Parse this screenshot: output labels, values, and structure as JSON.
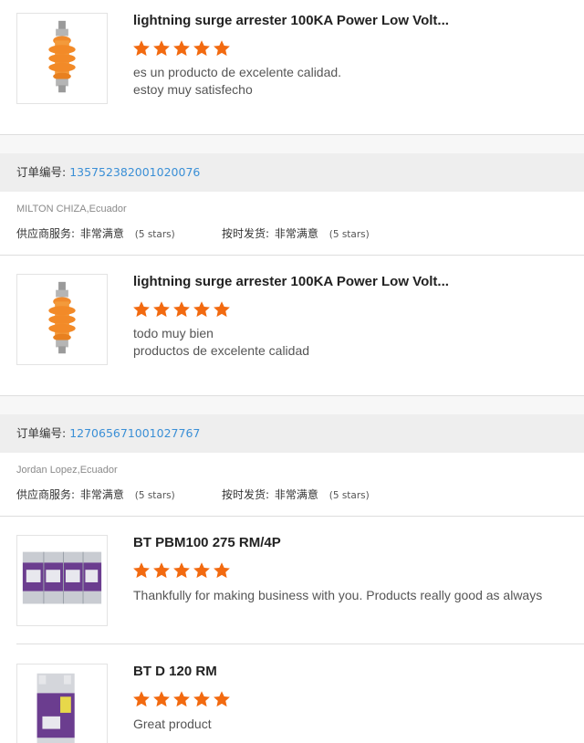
{
  "colors": {
    "star": "#f26a10",
    "order_link": "#3a8fd6"
  },
  "rating_stars": 5,
  "products_top": {
    "title": "lightning surge arrester 100KA Power Low Volt...",
    "review_lines": [
      "es un producto de excelente calidad.",
      "estoy muy satisfecho"
    ]
  },
  "orders": [
    {
      "label": "订单编号:",
      "number": "135752382001020076",
      "buyer": "MILTON CHIZA,Ecuador",
      "supplier_service_label": "供应商服务:",
      "supplier_service_value": "非常满意",
      "supplier_service_stars": "(5 stars)",
      "ontime_label": "按时发货:",
      "ontime_value": "非常满意",
      "ontime_stars": "(5 stars)",
      "items": [
        {
          "title": "lightning surge arrester 100KA Power Low Volt...",
          "review_lines": [
            "todo muy bien",
            "productos de excelente calidad"
          ]
        }
      ]
    },
    {
      "label": "订单编号:",
      "number": "127065671001027767",
      "buyer": "Jordan Lopez,Ecuador",
      "supplier_service_label": "供应商服务:",
      "supplier_service_value": "非常满意",
      "supplier_service_stars": "(5 stars)",
      "ontime_label": "按时发货:",
      "ontime_value": "非常满意",
      "ontime_stars": "(5 stars)",
      "items": [
        {
          "title": "BT PBM100 275 RM/4P",
          "review_lines": [
            "Thankfully for making business with you. Products really good as always"
          ]
        },
        {
          "title": "BT D 120 RM",
          "review_lines": [
            "Great product"
          ]
        }
      ]
    }
  ]
}
